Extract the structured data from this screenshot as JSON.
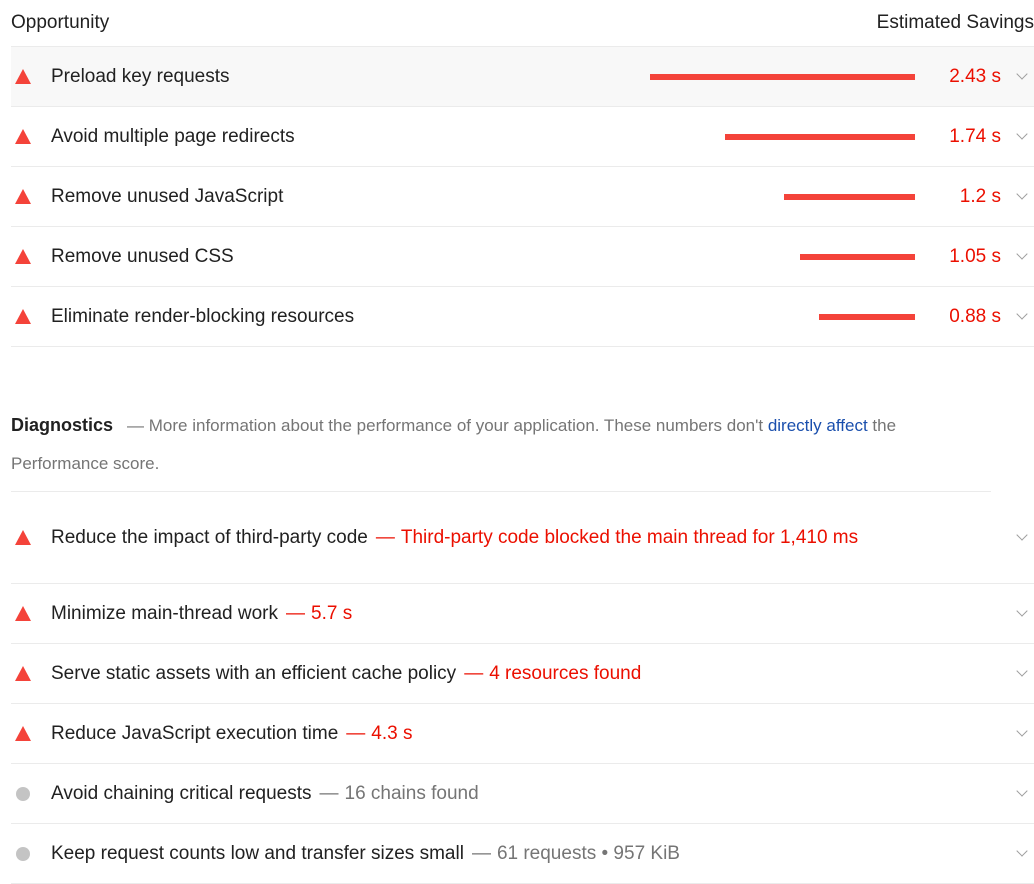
{
  "opportunities": {
    "header_left": "Opportunity",
    "header_right": "Estimated Savings",
    "items": [
      {
        "title": "Preload key requests",
        "savings": "2.43 s",
        "savings_seconds": 2.43
      },
      {
        "title": "Avoid multiple page redirects",
        "savings": "1.74 s",
        "savings_seconds": 1.74
      },
      {
        "title": "Remove unused JavaScript",
        "savings": "1.2 s",
        "savings_seconds": 1.2
      },
      {
        "title": "Remove unused CSS",
        "savings": "1.05 s",
        "savings_seconds": 1.05
      },
      {
        "title": "Eliminate render-blocking resources",
        "savings": "0.88 s",
        "savings_seconds": 0.88
      }
    ]
  },
  "diagnostics": {
    "title": "Diagnostics",
    "description_dash": "—",
    "description_pre": "More information about the performance of your application. These numbers don't ",
    "link_text": "directly affect",
    "description_post": " the Performance score.",
    "items": [
      {
        "status": "fail",
        "title": "Reduce the impact of third-party code",
        "dash": "—",
        "detail": "Third-party code blocked the main thread for 1,410 ms"
      },
      {
        "status": "fail",
        "title": "Minimize main-thread work",
        "dash": "—",
        "detail": "5.7 s"
      },
      {
        "status": "fail",
        "title": "Serve static assets with an efficient cache policy",
        "dash": "—",
        "detail": "4 resources found"
      },
      {
        "status": "fail",
        "title": "Reduce JavaScript execution time",
        "dash": "—",
        "detail": "4.3 s"
      },
      {
        "status": "neutral",
        "title": "Avoid chaining critical requests",
        "dash": "—",
        "detail": "16 chains found"
      },
      {
        "status": "neutral",
        "title": "Keep request counts low and transfer sizes small",
        "dash": "—",
        "detail": "61 requests • 957 KiB"
      }
    ]
  },
  "colors": {
    "fail": "#f4433a",
    "fail_text": "#eb0f00",
    "neutral": "#c4c4c4",
    "link": "#1a4fad"
  },
  "icons": {
    "fail": "warning-triangle-icon",
    "neutral": "gray-circle-icon",
    "expand": "chevron-down-icon"
  }
}
